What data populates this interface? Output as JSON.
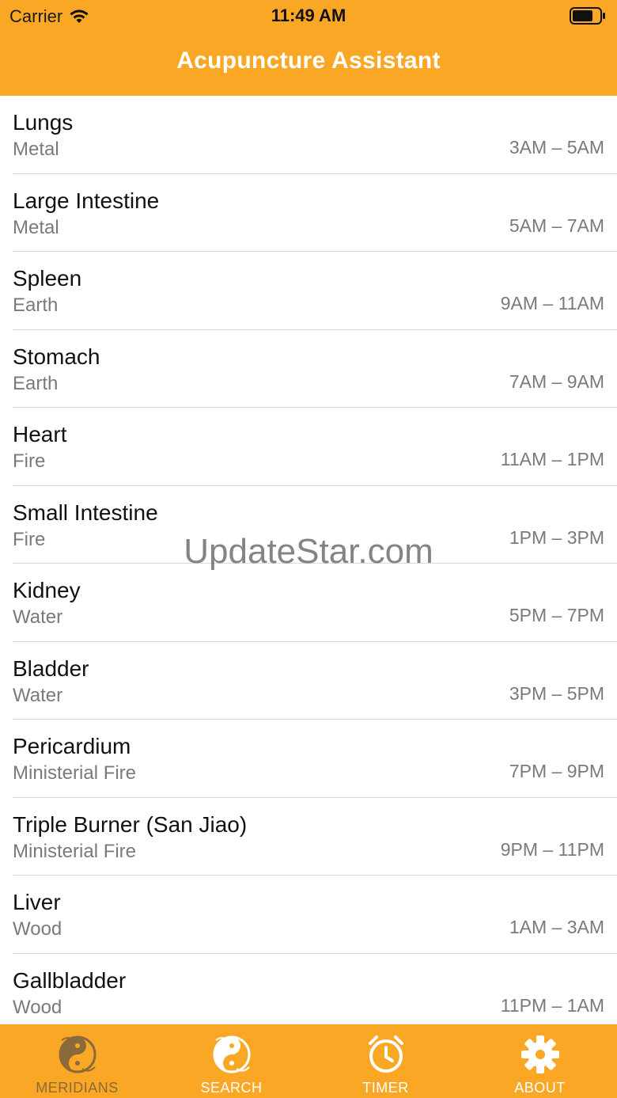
{
  "status_bar": {
    "carrier": "Carrier",
    "time": "11:49 AM"
  },
  "header": {
    "title": "Acupuncture Assistant"
  },
  "meridians": [
    {
      "name": "Lungs",
      "element": "Metal",
      "time": "3AM – 5AM"
    },
    {
      "name": "Large Intestine",
      "element": "Metal",
      "time": "5AM – 7AM"
    },
    {
      "name": "Spleen",
      "element": "Earth",
      "time": "9AM – 11AM"
    },
    {
      "name": "Stomach",
      "element": "Earth",
      "time": "7AM – 9AM"
    },
    {
      "name": "Heart",
      "element": "Fire",
      "time": "11AM – 1PM"
    },
    {
      "name": "Small Intestine",
      "element": "Fire",
      "time": "1PM – 3PM"
    },
    {
      "name": "Kidney",
      "element": "Water",
      "time": "5PM – 7PM"
    },
    {
      "name": "Bladder",
      "element": "Water",
      "time": "3PM – 5PM"
    },
    {
      "name": "Pericardium",
      "element": "Ministerial Fire",
      "time": "7PM – 9PM"
    },
    {
      "name": "Triple Burner (San Jiao)",
      "element": "Ministerial Fire",
      "time": "9PM – 11PM"
    },
    {
      "name": "Liver",
      "element": "Wood",
      "time": "1AM – 3AM"
    },
    {
      "name": "Gallbladder",
      "element": "Wood",
      "time": "11PM – 1AM"
    }
  ],
  "watermark": "UpdateStar.com",
  "tabbar": {
    "meridians": "MERIDIANS",
    "search": "SEARCH",
    "timer": "TIMER",
    "about": "ABOUT"
  },
  "colors": {
    "accent": "#fba726",
    "active_tab": "#8a6a3a"
  }
}
